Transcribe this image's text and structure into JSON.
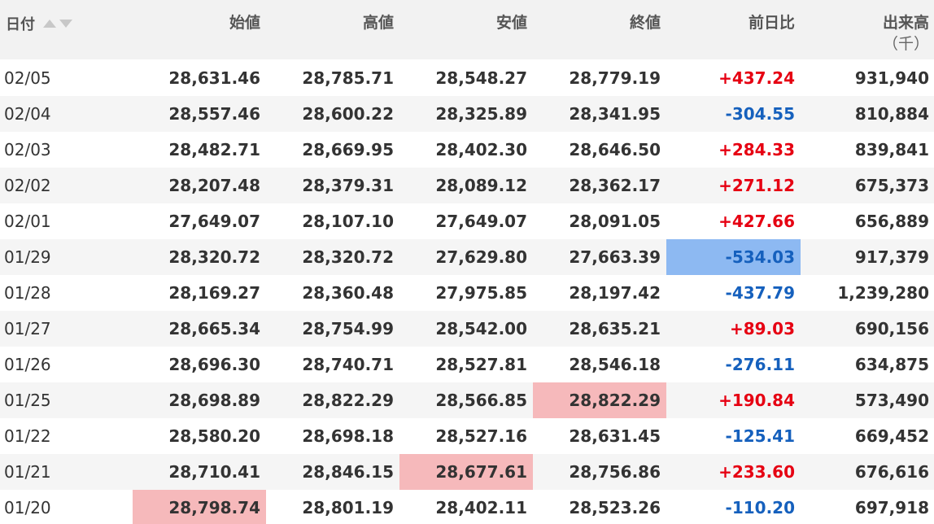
{
  "header": {
    "date": "日付",
    "open": "始値",
    "high": "高値",
    "low": "安値",
    "close": "終値",
    "change": "前日比",
    "volume": "出来高",
    "volume_unit": "（千）",
    "sort_up_icon": "triangle-up-icon",
    "sort_down_icon": "triangle-down-icon"
  },
  "colors": {
    "positive": "#e60012",
    "negative": "#1560bd",
    "highlight_red": "#f6b9bb",
    "highlight_blue": "#8db9f2",
    "header_bg": "#f2f2f2",
    "alt_row_bg": "#f5f5f5"
  },
  "rows": [
    {
      "date": "02/05",
      "open": "28,631.46",
      "high": "28,785.71",
      "low": "28,548.27",
      "close": "28,779.19",
      "change": "+437.24",
      "volume": "931,940"
    },
    {
      "date": "02/04",
      "open": "28,557.46",
      "high": "28,600.22",
      "low": "28,325.89",
      "close": "28,341.95",
      "change": "-304.55",
      "volume": "810,884"
    },
    {
      "date": "02/03",
      "open": "28,482.71",
      "high": "28,669.95",
      "low": "28,402.30",
      "close": "28,646.50",
      "change": "+284.33",
      "volume": "839,841"
    },
    {
      "date": "02/02",
      "open": "28,207.48",
      "high": "28,379.31",
      "low": "28,089.12",
      "close": "28,362.17",
      "change": "+271.12",
      "volume": "675,373"
    },
    {
      "date": "02/01",
      "open": "27,649.07",
      "high": "28,107.10",
      "low": "27,649.07",
      "close": "28,091.05",
      "change": "+427.66",
      "volume": "656,889"
    },
    {
      "date": "01/29",
      "open": "28,320.72",
      "high": "28,320.72",
      "low": "27,629.80",
      "close": "27,663.39",
      "change": "-534.03",
      "volume": "917,379"
    },
    {
      "date": "01/28",
      "open": "28,169.27",
      "high": "28,360.48",
      "low": "27,975.85",
      "close": "28,197.42",
      "change": "-437.79",
      "volume": "1,239,280"
    },
    {
      "date": "01/27",
      "open": "28,665.34",
      "high": "28,754.99",
      "low": "28,542.00",
      "close": "28,635.21",
      "change": "+89.03",
      "volume": "690,156"
    },
    {
      "date": "01/26",
      "open": "28,696.30",
      "high": "28,740.71",
      "low": "28,527.81",
      "close": "28,546.18",
      "change": "-276.11",
      "volume": "634,875"
    },
    {
      "date": "01/25",
      "open": "28,698.89",
      "high": "28,822.29",
      "low": "28,566.85",
      "close": "28,822.29",
      "change": "+190.84",
      "volume": "573,490"
    },
    {
      "date": "01/22",
      "open": "28,580.20",
      "high": "28,698.18",
      "low": "28,527.16",
      "close": "28,631.45",
      "change": "-125.41",
      "volume": "669,452"
    },
    {
      "date": "01/21",
      "open": "28,710.41",
      "high": "28,846.15",
      "low": "28,677.61",
      "close": "28,756.86",
      "change": "+233.60",
      "volume": "676,616"
    },
    {
      "date": "01/20",
      "open": "28,798.74",
      "high": "28,801.19",
      "low": "28,402.11",
      "close": "28,523.26",
      "change": "-110.20",
      "volume": "697,918"
    }
  ]
}
